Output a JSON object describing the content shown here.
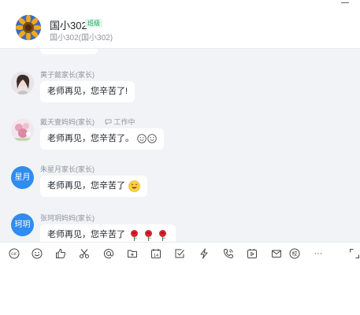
{
  "header": {
    "title": "国小302",
    "badge": "班级",
    "subtitle": "国小302(国小302)"
  },
  "messages": [
    {
      "sender": "黄子懿家长(家长)",
      "text": "老师再见，您辛苦了!",
      "avatar_type": "photo-girl",
      "emojis": []
    },
    {
      "sender": "戴天壹妈妈(家长)",
      "status": "工作中",
      "text": "老师再见，您辛苦了。",
      "avatar_type": "photo-flowers",
      "emojis": [
        "smile-emoji",
        "smile-emoji"
      ]
    },
    {
      "sender": "朱星月家长(家长)",
      "text": "老师再见，您辛苦了",
      "avatar_type": "text",
      "avatar_text": "星月",
      "emojis": [
        "grin-emoji"
      ]
    },
    {
      "sender": "张珂玥妈妈(家长)",
      "text": "老师再见，您辛苦了",
      "avatar_type": "text",
      "avatar_text": "珂玥",
      "emojis": [
        "rose-emoji",
        "rose-emoji",
        "rose-emoji"
      ]
    }
  ],
  "toolbar": {
    "icons": [
      "gif-icon",
      "emoji-icon",
      "thumbs-up-icon",
      "scissors-icon",
      "at-icon",
      "folder-icon",
      "calendar-icon",
      "checkbox-icon",
      "lightning-icon",
      "phone-icon",
      "video-icon",
      "mail-icon",
      "school-icon",
      "more-icon",
      "expand-icon"
    ],
    "calendar_day": "14",
    "school_label": "校",
    "more_label": "···"
  },
  "colors": {
    "chat_bg": "#f1f3f6",
    "avatar_blue": "#2f8cf0",
    "badge_green": "#22a86b"
  }
}
